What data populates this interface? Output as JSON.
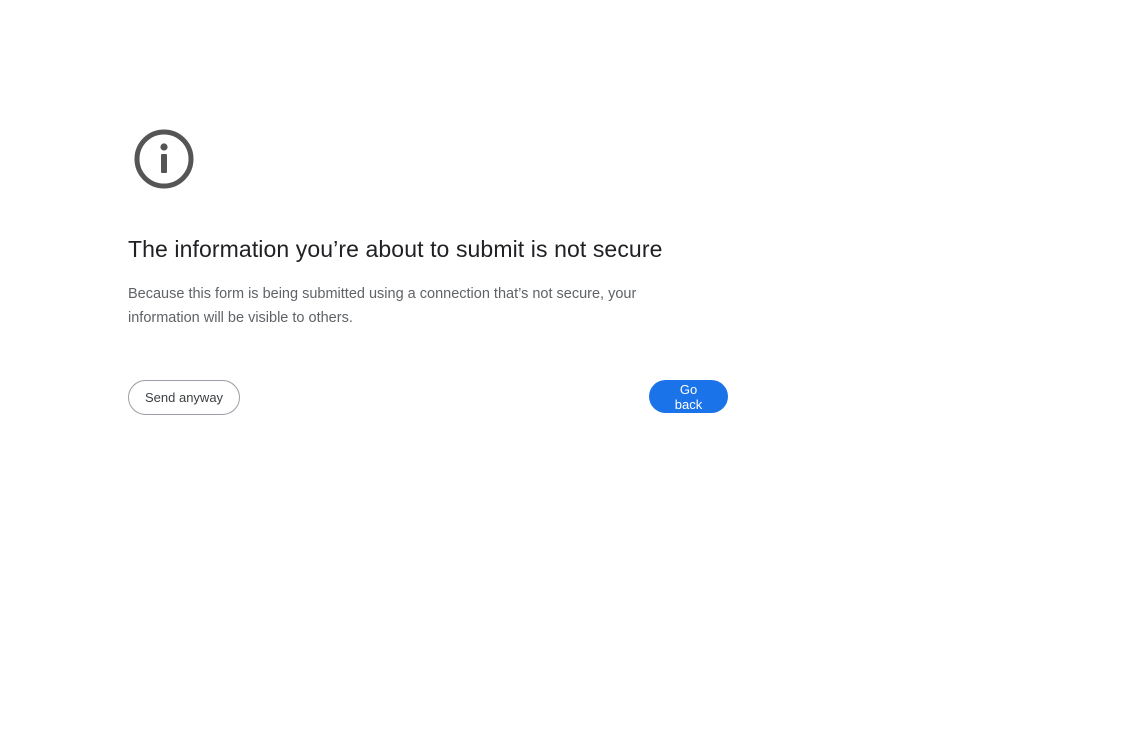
{
  "interstitial": {
    "icon": "info-circle-icon",
    "icon_color": "#555555",
    "title": "The information you’re about to submit is not secure",
    "description": "Because this form is being submitted using a connection that’s not secure, your information will be visible to others.",
    "send_anyway_label": "Send anyway",
    "go_back_label": "Go back",
    "accent_color": "#1a73e8"
  }
}
